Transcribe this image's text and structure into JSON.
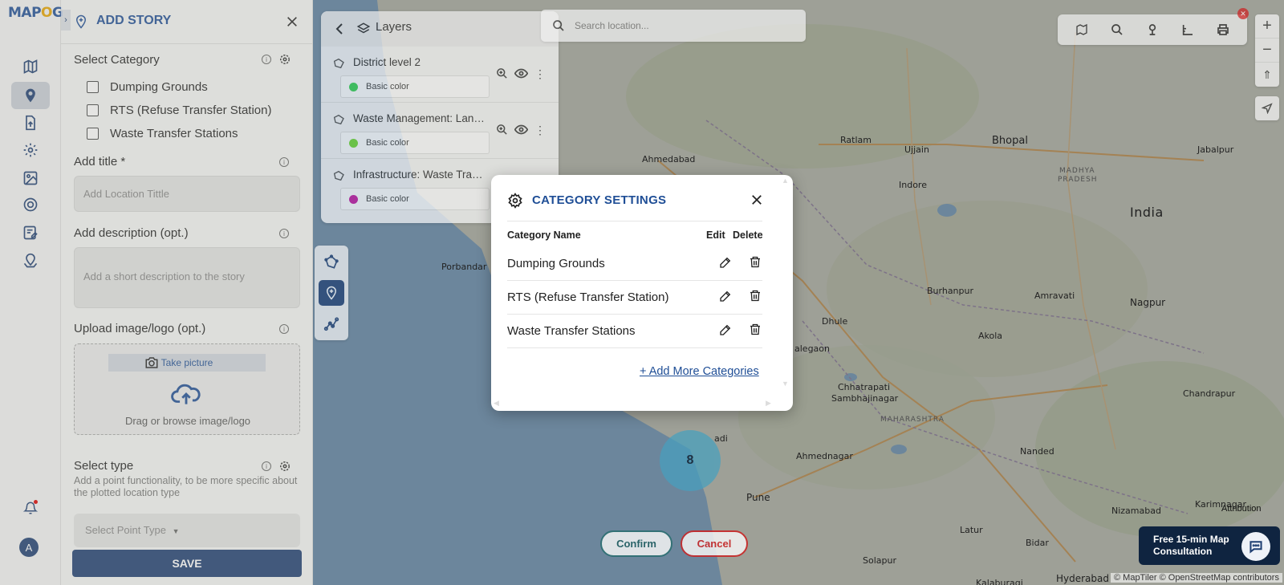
{
  "app": {
    "logo_a": "MAP",
    "logo_o": "O",
    "logo_b": "G"
  },
  "rail": {
    "items": [
      {
        "icon": "map-icon"
      },
      {
        "icon": "location-pin-icon",
        "active": true
      },
      {
        "icon": "upload-icon"
      },
      {
        "icon": "settings-gear-icon"
      },
      {
        "icon": "gallery-icon"
      },
      {
        "icon": "cog-icon"
      },
      {
        "icon": "form-edit-icon"
      },
      {
        "icon": "map-pin-check-icon"
      }
    ],
    "avatar_letter": "A"
  },
  "panel": {
    "title": "ADD STORY",
    "select_category_label": "Select Category",
    "categories": [
      "Dumping Grounds",
      "RTS (Refuse Transfer Station)",
      "Waste Transfer Stations"
    ],
    "add_title_label": "Add title *",
    "add_title_placeholder": "Add Location Tittle",
    "add_desc_label": "Add description (opt.)",
    "add_desc_placeholder": "Add a short description to the story",
    "upload_label": "Upload image/logo (opt.)",
    "take_picture": "Take picture",
    "drag_text": "Drag or browse image/logo",
    "select_type_label": "Select type",
    "select_type_sub": "Add a point functionality, to be more specific about the plotted location type",
    "select_point_placeholder": "Select Point Type",
    "save_label": "SAVE"
  },
  "layers": {
    "title": "Layers",
    "items": [
      {
        "name": "District level 2",
        "color_label": "Basic color",
        "color": "#2fd04a"
      },
      {
        "name": "Waste Management: Landfill Sites",
        "color_label": "Basic color",
        "color": "#6ad82a"
      },
      {
        "name": "Infrastructure: Waste Transfer",
        "color_label": "Basic color",
        "color": "#c3109c"
      }
    ]
  },
  "search": {
    "placeholder": "Search location..."
  },
  "map": {
    "cities": {
      "ahmedabad": "Ahmedabad",
      "ujjain": "Ujjain",
      "bhopal": "Bhopal",
      "ratlam": "Ratlam",
      "jabalpur": "Jabalpur",
      "indore": "Indore",
      "india": "India",
      "madhya": "MADHYA",
      "pradesh": "PRADESH",
      "porbandar": "Porbandar",
      "burhanpur": "Burhanpur",
      "nagpur": "Nagpur",
      "amravati": "Amravati",
      "dhule": "Dhule",
      "akola": "Akola",
      "malegaon": "alegaon",
      "chhatrapati": "Chhatrapati",
      "sambhajinagar": "Sambhajinagar",
      "chandrapur": "Chandrapur",
      "maharashtra": "MAHARASHTRA",
      "ahmednagar": "Ahmednagar",
      "nanded": "Nanded",
      "pune": "Pune",
      "nizamabad": "Nizamabad",
      "karimnagar": "Karimnagar",
      "latur": "Latur",
      "bidar": "Bidar",
      "solapur": "Solapur",
      "hyderabad": "Hyderabad",
      "kalaburagi": "Kalaburagi",
      "nadi": "adi"
    },
    "cluster_count": "8",
    "confirm": "Confirm",
    "cancel": "Cancel",
    "attribution": "Attribution",
    "copyright": "© MapTiler © OpenStreetMap contributors",
    "consult_line1": "Free 15-min Map",
    "consult_line2": "Consultation"
  },
  "modal": {
    "title": "CATEGORY SETTINGS",
    "col_name": "Category Name",
    "col_edit": "Edit",
    "col_delete": "Delete",
    "rows": [
      "Dumping Grounds",
      "RTS (Refuse Transfer Station)",
      "Waste Transfer Stations"
    ],
    "add_more": "+ Add More Categories"
  }
}
